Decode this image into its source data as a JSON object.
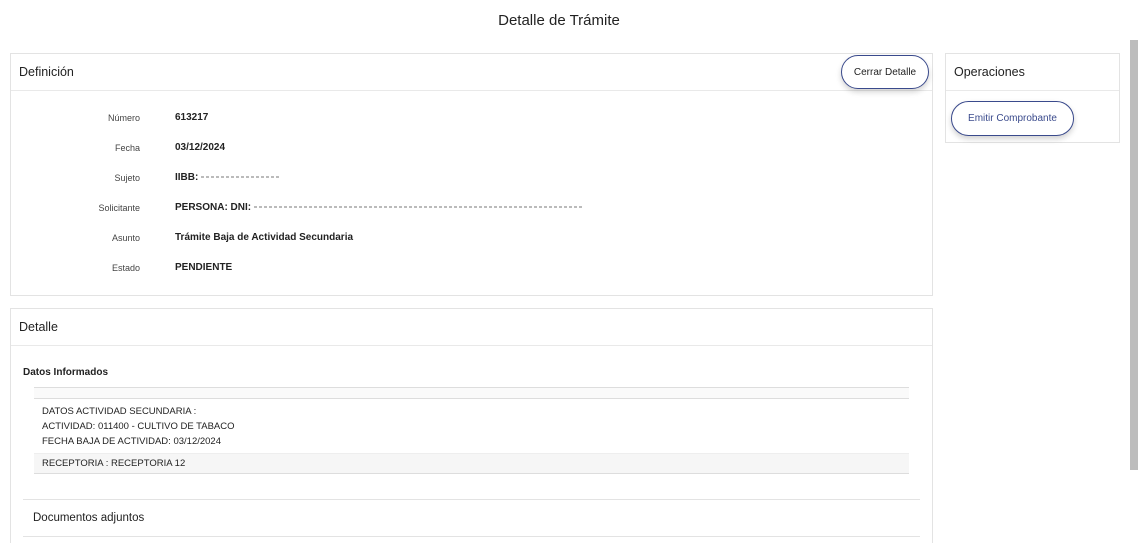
{
  "page_title": "Detalle de Trámite",
  "definition": {
    "title": "Definición",
    "close_button": "Cerrar Detalle",
    "fields": [
      {
        "label": "Número",
        "value": "613217"
      },
      {
        "label": "Fecha",
        "value": "03/12/2024"
      },
      {
        "label": "Sujeto",
        "value": "IIBB:"
      },
      {
        "label": "Solicitante",
        "value": "PERSONA: DNI:"
      },
      {
        "label": "Asunto",
        "value": "Trámite Baja de Actividad Secundaria"
      },
      {
        "label": "Estado",
        "value": "PENDIENTE"
      }
    ]
  },
  "operations": {
    "title": "Operaciones",
    "emit_button": "Emitir Comprobante"
  },
  "detail": {
    "title": "Detalle",
    "reported_data_title": "Datos Informados",
    "reported_lines": [
      "DATOS ACTIVIDAD SECUNDARIA :",
      "ACTIVIDAD: 011400 - CULTIVO DE TABACO",
      "FECHA BAJA DE ACTIVIDAD: 03/12/2024"
    ],
    "receptoria": "RECEPTORIA : RECEPTORIA 12",
    "documents_title": "Documentos adjuntos"
  }
}
